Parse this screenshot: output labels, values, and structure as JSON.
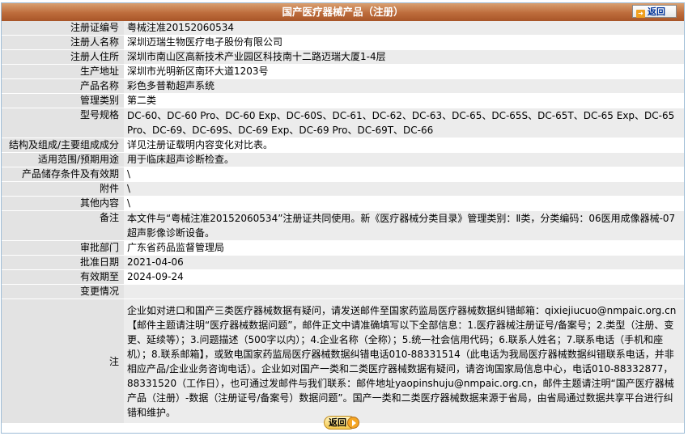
{
  "header": {
    "title": "国产医疗器械产品（注册）",
    "back_label": "返回"
  },
  "rows": [
    {
      "label": "注册证编号",
      "value": "粤械注准20152060534"
    },
    {
      "label": "注册人名称",
      "value": "深圳迈瑞生物医疗电子股份有限公司"
    },
    {
      "label": "注册人住所",
      "value": "深圳市南山区高新技术产业园区科技南十二路迈瑞大厦1-4层"
    },
    {
      "label": "生产地址",
      "value": "深圳市光明新区南环大道1203号"
    },
    {
      "label": "产品名称",
      "value": "彩色多普勒超声系统"
    },
    {
      "label": "管理类别",
      "value": "第二类"
    },
    {
      "label": "型号规格",
      "value": "DC-60、DC-60 Pro、DC-60 Exp、DC-60S、DC-61、DC-62、DC-63、DC-65、DC-65S、DC-65T、DC-65 Exp、DC-65 Pro、DC-69、DC-69S、DC-69 Exp、DC-69 Pro、DC-69T、DC-66"
    },
    {
      "label": "结构及组成/主要组成成分",
      "value": "详见注册证载明内容变化对比表。"
    },
    {
      "label": "适用范围/预期用途",
      "value": "用于临床超声诊断检查。"
    },
    {
      "label": "产品储存条件及有效期",
      "value": "\\"
    },
    {
      "label": "附件",
      "value": "\\"
    },
    {
      "label": "其他内容",
      "value": "\\"
    },
    {
      "label": "备注",
      "value": "本文件与“粤械注准20152060534”注册证共同使用。新《医疗器械分类目录》管理类别：Ⅱ类，分类编码：06医用成像器械-07超声影像诊断设备。"
    },
    {
      "label": "审批部门",
      "value": "广东省药品监督管理局"
    },
    {
      "label": "批准日期",
      "value": "2021-04-06"
    },
    {
      "label": "有效期至",
      "value": "2024-09-24"
    },
    {
      "label": "变更情况",
      "value": ""
    }
  ],
  "notes": {
    "label": "注",
    "text": "企业如对进口和国产三类医疗器械数据有疑问，请发送邮件至国家药监局医疗器械数据纠错邮箱：qixiejiucuo@nmpaic.org.cn【邮件主题请注明“医疗器械数据问题”，邮件正文中请准确填写以下全部信息：1.医疗器械注册证号/备案号；2.类型（注册、变更、延续等）；3.问题描述（500字以内）；4.企业名称（全称）；5.统一社会信用代码；6.联系人姓名；7.联系电话（手机和座机）；8.联系邮箱】，或致电国家药监局医疗器械数据纠错电话010-88331514（此电话为我局医疗器械数据纠错联系电话，并非相应产品/企业业务咨询电话）。企业如对国产一类和二类医疗器械数据有疑问，请咨询国家局信息中心，电话010-88332877，88331520（工作日），也可通过发邮件与我们联系：邮件地址yaopinshuju@nmpaic.org.cn，邮件主题请注明“国产医疗器械产品（注册）-数据（注册证号/备案号）数据问题”。国产一类和二类医疗器械数据来源于省局，由省局通过数据共享平台进行纠错和维护。"
  },
  "footer": {
    "back_label": "返回"
  }
}
